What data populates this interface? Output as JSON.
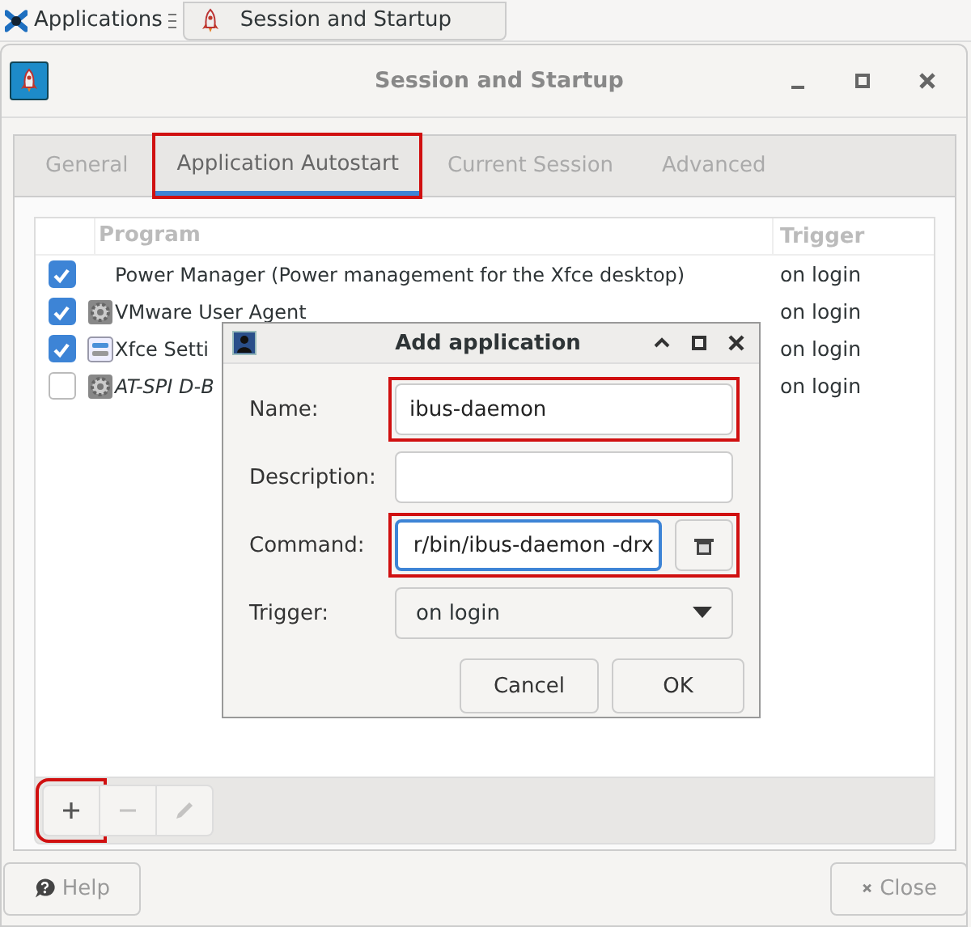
{
  "taskbar": {
    "menu_label": "Applications",
    "tasks": [
      {
        "label": "Session and Startup"
      }
    ]
  },
  "window": {
    "title": "Session and Startup"
  },
  "tabs": [
    {
      "label": "General",
      "selected": false,
      "highlighted": false
    },
    {
      "label": "Application Autostart",
      "selected": true,
      "highlighted": true
    },
    {
      "label": "Current Session",
      "selected": false,
      "highlighted": false
    },
    {
      "label": "Advanced",
      "selected": false,
      "highlighted": false
    }
  ],
  "table": {
    "columns": [
      "Program",
      "Trigger"
    ],
    "rows": [
      {
        "checked": true,
        "kind": "plain",
        "program": "Power Manager (Power management for the Xfce desktop)",
        "italic": false,
        "trigger": "on login"
      },
      {
        "checked": true,
        "kind": "service",
        "program": "VMware User Agent",
        "italic": false,
        "trigger": "on login"
      },
      {
        "checked": true,
        "kind": "settings",
        "program": "Xfce Setti",
        "italic": false,
        "trigger": "on login"
      },
      {
        "checked": false,
        "kind": "service",
        "program": "AT-SPI D-B",
        "italic": true,
        "trigger": "on login"
      }
    ]
  },
  "toolbar": [
    {
      "kind": "add",
      "disabled": false,
      "highlighted": true
    },
    {
      "kind": "remove",
      "disabled": true,
      "highlighted": false
    },
    {
      "kind": "edit",
      "disabled": true,
      "highlighted": false
    }
  ],
  "buttons": [
    {
      "kind": "help",
      "label": "Help"
    },
    {
      "kind": "close",
      "label": "Close"
    }
  ],
  "dialog": {
    "title": "Add application",
    "fields": [
      {
        "kind": "text",
        "label": "Name:",
        "value": "ibus-daemon",
        "highlighted": true
      },
      {
        "kind": "text",
        "label": "Description:",
        "highlighted": false
      },
      {
        "kind": "command",
        "label": "Command:",
        "value": "r/bin/ibus-daemon -drx",
        "focused": true,
        "highlighted": true
      },
      {
        "kind": "select",
        "label": "Trigger:",
        "value": "on login",
        "highlighted": false
      }
    ],
    "buttons": [
      "Cancel",
      "OK"
    ]
  }
}
